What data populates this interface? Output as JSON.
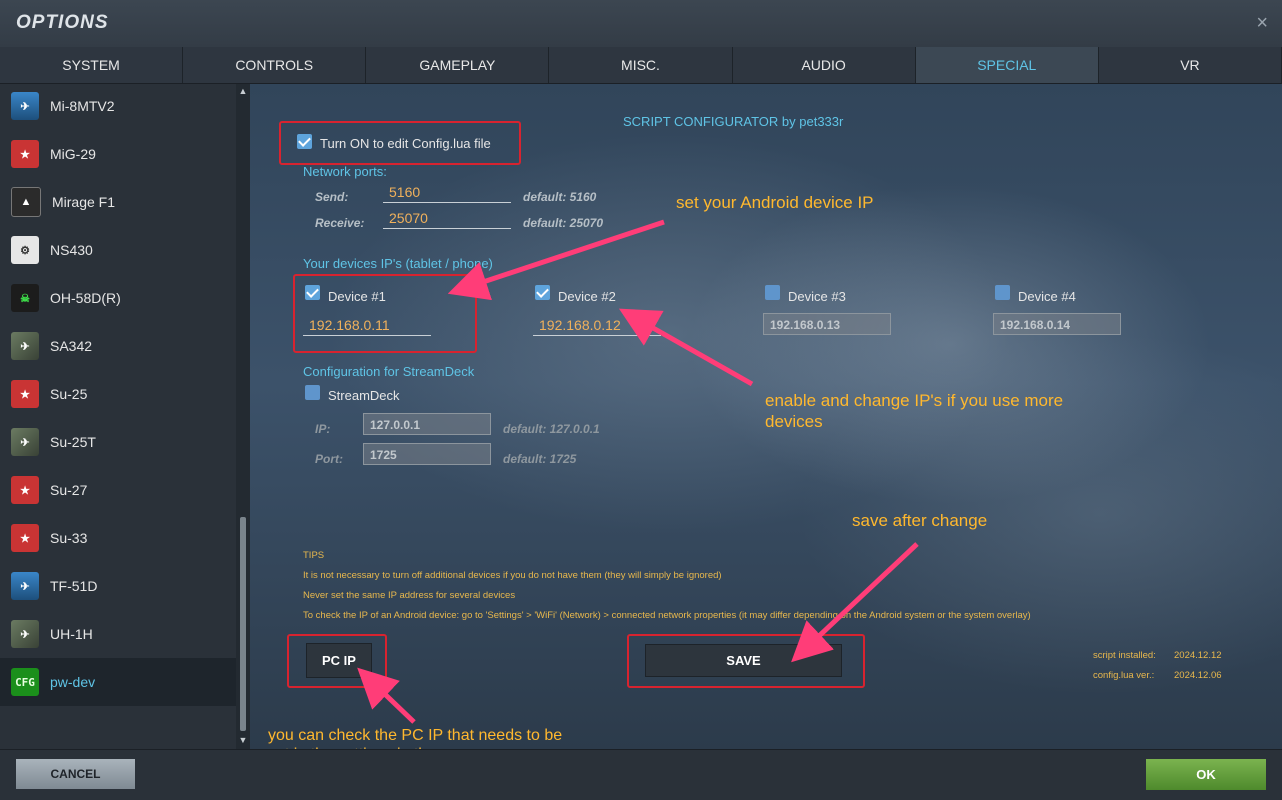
{
  "window": {
    "title": "OPTIONS",
    "close_label": "×"
  },
  "tabs": [
    {
      "label": "SYSTEM",
      "active": false
    },
    {
      "label": "CONTROLS",
      "active": false
    },
    {
      "label": "GAMEPLAY",
      "active": false
    },
    {
      "label": "MISC.",
      "active": false
    },
    {
      "label": "AUDIO",
      "active": false
    },
    {
      "label": "SPECIAL",
      "active": true
    },
    {
      "label": "VR",
      "active": false
    }
  ],
  "sidebar": {
    "items": [
      {
        "label": "Mi-8MTV2",
        "icon": "helicopter-icon"
      },
      {
        "label": "MiG-29",
        "icon": "shield-icon"
      },
      {
        "label": "Mirage F1",
        "icon": "jet-icon"
      },
      {
        "label": "NS430",
        "icon": "gear-icon"
      },
      {
        "label": "OH-58D(R)",
        "icon": "skull-icon"
      },
      {
        "label": "SA342",
        "icon": "helicopter-icon"
      },
      {
        "label": "Su-25",
        "icon": "shield-icon"
      },
      {
        "label": "Su-25T",
        "icon": "jet-icon"
      },
      {
        "label": "Su-27",
        "icon": "shield-icon"
      },
      {
        "label": "Su-33",
        "icon": "shield-icon"
      },
      {
        "label": "TF-51D",
        "icon": "plane-icon"
      },
      {
        "label": "UH-1H",
        "icon": "helicopter-icon"
      },
      {
        "label": "pw-dev",
        "icon": "cfg-icon",
        "badge": "CFG",
        "active": true
      }
    ]
  },
  "config": {
    "title": "SCRIPT CONFIGURATOR by pet333r",
    "enable_label": "Turn ON to edit Config.lua file",
    "enable_checked": true,
    "network": {
      "header": "Network ports:",
      "send_label": "Send:",
      "send_value": "5160",
      "send_default": "default: 5160",
      "receive_label": "Receive:",
      "receive_value": "25070",
      "receive_default": "default: 25070"
    },
    "devices_header": "Your devices IP's (tablet / phone)",
    "devices": [
      {
        "label": "Device #1",
        "checked": true,
        "ip": "192.168.0.11"
      },
      {
        "label": "Device #2",
        "checked": true,
        "ip": "192.168.0.12"
      },
      {
        "label": "Device #3",
        "checked": false,
        "ip": "192.168.0.13"
      },
      {
        "label": "Device #4",
        "checked": false,
        "ip": "192.168.0.14"
      }
    ],
    "streamdeck": {
      "header": "Configuration for StreamDeck",
      "label": "StreamDeck",
      "checked": false,
      "ip_label": "IP:",
      "ip_value": "127.0.0.1",
      "ip_default": "default: 127.0.0.1",
      "port_label": "Port:",
      "port_value": "1725",
      "port_default": "default: 1725"
    },
    "tips": {
      "header": "TIPS",
      "lines": [
        "It is not necessary to turn off additional devices if you do not have them (they will simply be ignored)",
        "Never set the same IP address for several devices",
        "To check the IP of an Android device: go to 'Settings' > 'WiFi' (Network) > connected network properties (it may differ depending on the Android system or the system overlay)"
      ]
    },
    "pc_ip_button": "PC IP",
    "save_button": "SAVE",
    "script_installed_label": "script installed:",
    "script_installed_value": "2024.12.12",
    "config_ver_label": "config.lua ver.:",
    "config_ver_value": "2024.12.06"
  },
  "annotations": {
    "set_ip": "set your Android device IP",
    "enable_change": "enable and change IP's if you use more devices",
    "save_after": "save after change",
    "pc_ip_note": "you can check the PC IP that needs to be set in the settings in the app"
  },
  "footer": {
    "cancel": "CANCEL",
    "ok": "OK"
  },
  "colors": {
    "accent": "#5fc4e6",
    "field_value": "#f0b15c",
    "annotation": "#ffb82e",
    "highlight_box": "#d8232f",
    "arrow": "#ff3d78",
    "ok_green": "#5e9c37"
  }
}
